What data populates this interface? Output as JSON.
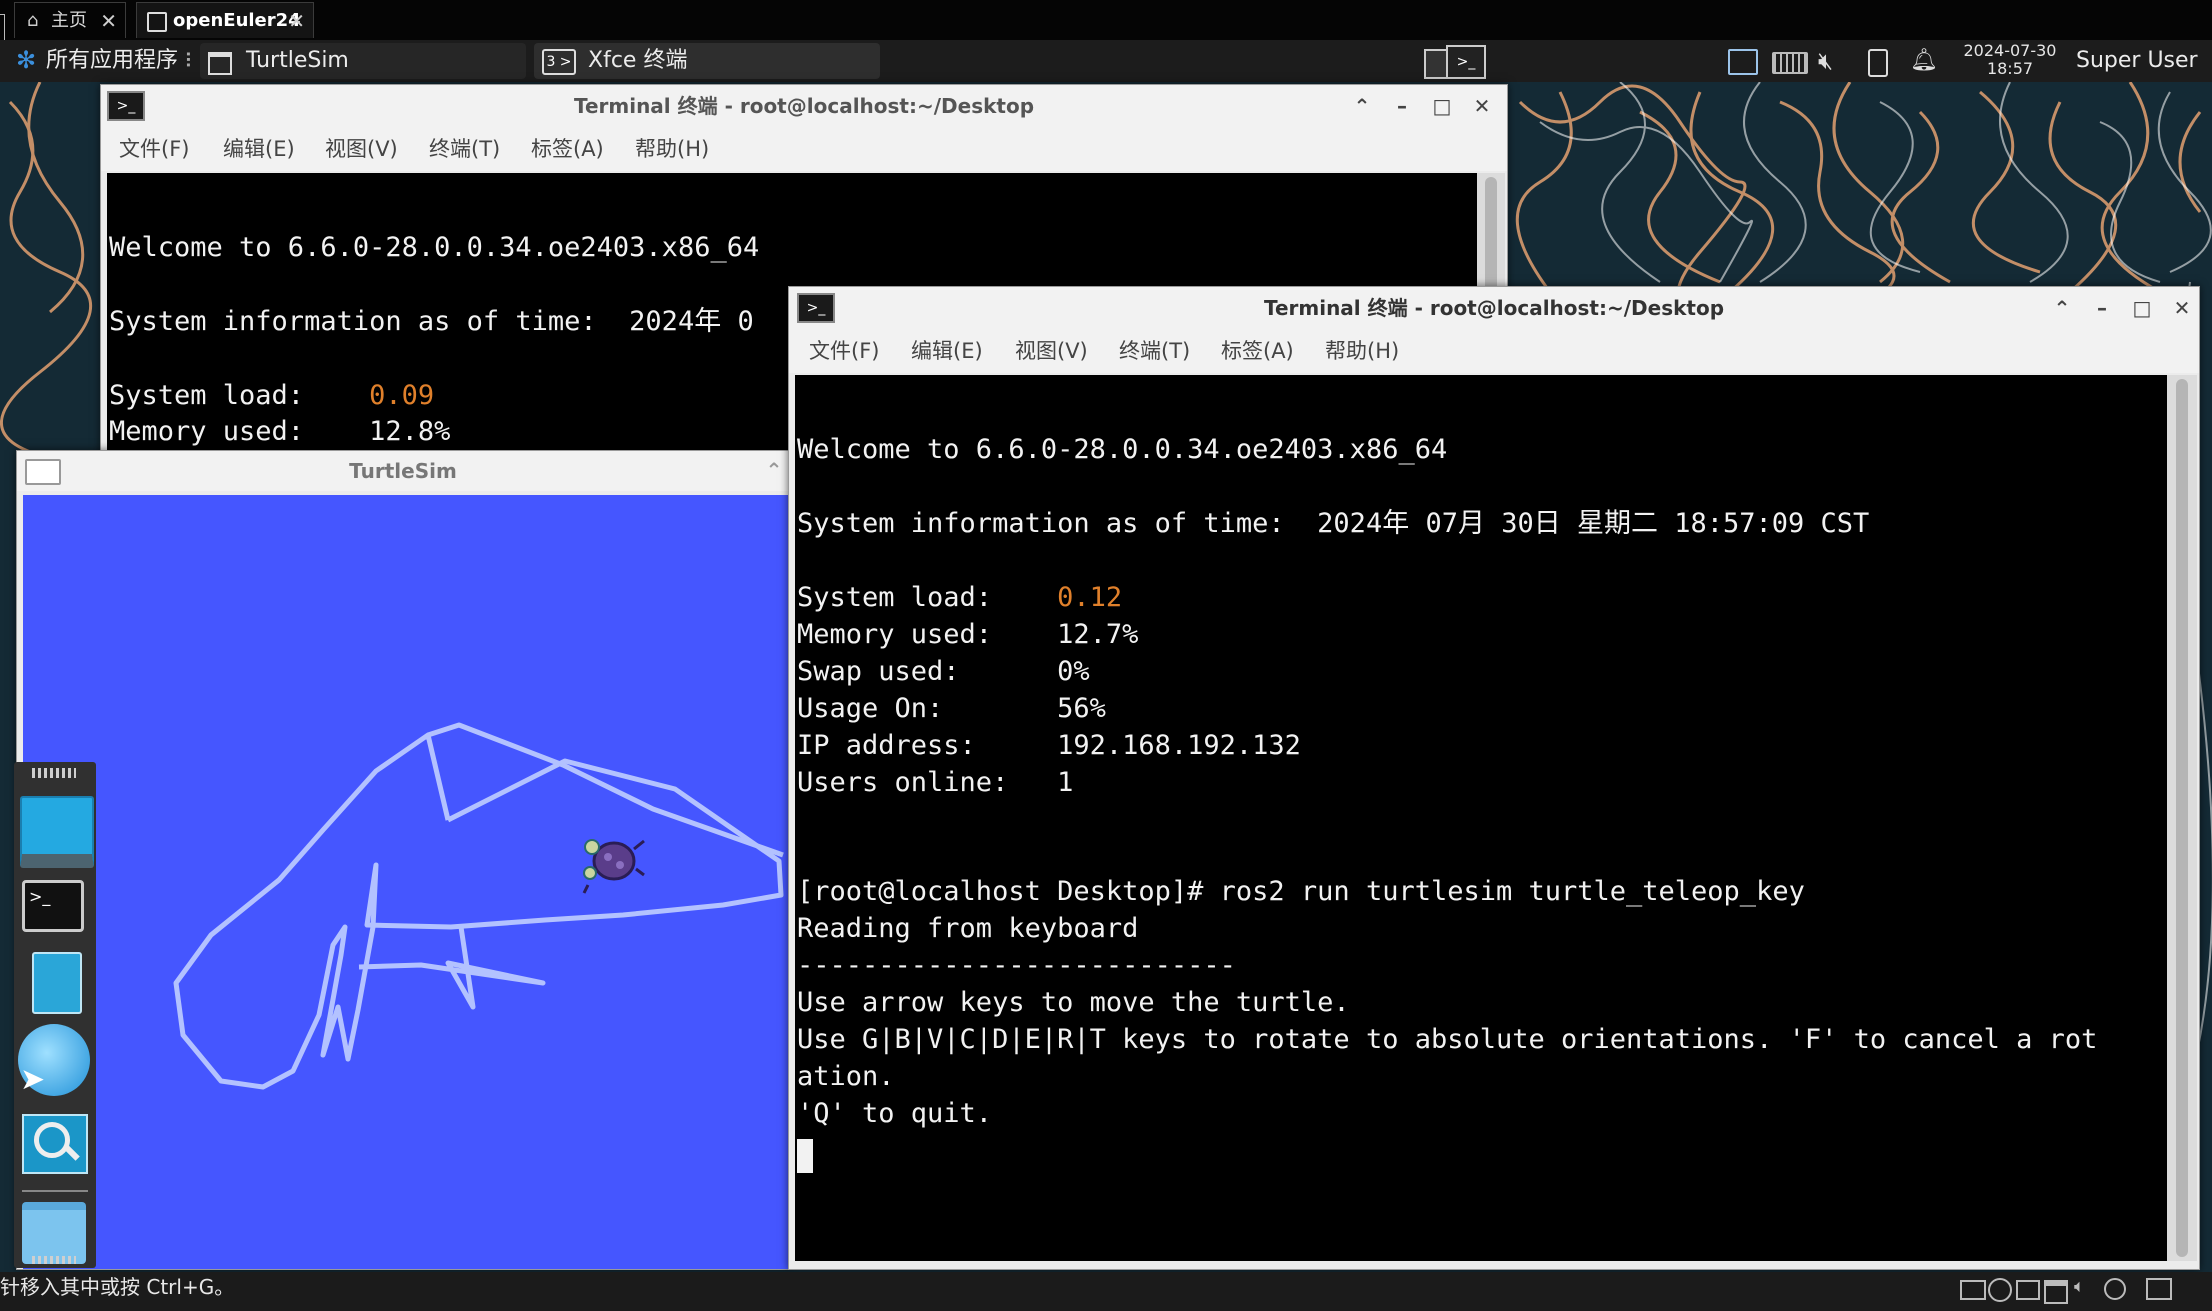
{
  "vm_tabs": [
    {
      "label": "主页",
      "active": false
    },
    {
      "label": "openEuler24",
      "active": true
    }
  ],
  "panel": {
    "apps_menu": "所有应用程序",
    "tasks": [
      {
        "label": "TurtleSim"
      },
      {
        "label": "Xfce 终端"
      }
    ],
    "clock_date": "2024-07-30",
    "clock_time": "18:57",
    "user": "Super User"
  },
  "terminal_back": {
    "title": "Terminal 终端 - root@localhost:~/Desktop",
    "menus": [
      "文件(F)",
      "编辑(E)",
      "视图(V)",
      "终端(T)",
      "标签(A)",
      "帮助(H)"
    ],
    "welcome": "Welcome to 6.6.0-28.0.0.34.oe2403.x86_64",
    "sysinfo": "System information as of time:  2024年 0",
    "load_label": "System load:    ",
    "load_value": "0.09",
    "mem_partial": "Memory used:    12.8%"
  },
  "turtlesim": {
    "title": "TurtleSim",
    "background": "#4556ff",
    "path_color": "#b3c2ff"
  },
  "terminal_front": {
    "title": "Terminal 终端 - root@localhost:~/Desktop",
    "menus": [
      "文件(F)",
      "编辑(E)",
      "视图(V)",
      "终端(T)",
      "标签(A)",
      "帮助(H)"
    ],
    "welcome": "Welcome to 6.6.0-28.0.0.34.oe2403.x86_64",
    "sysinfo": "System information as of time:  2024年 07月 30日 星期二 18:57:09 CST",
    "load_label": "System load:    ",
    "load_value": "0.12",
    "memory": "Memory used:    12.7%",
    "swap": "Swap used:      0%",
    "usage": "Usage On:       56%",
    "ip": "IP address:     192.168.192.132",
    "users": "Users online:   1",
    "command": "[root@localhost Desktop]# ros2 run turtlesim turtle_teleop_key",
    "reading": "Reading from keyboard",
    "divider": "---------------------------",
    "hint1": "Use arrow keys to move the turtle.",
    "hint2a": "Use G|B|V|C|D|E|R|T keys to rotate to absolute orientations. 'F' to cancel a rot",
    "hint2b": "ation.",
    "quit": "'Q' to quit."
  },
  "status_hint": "针移入其中或按 Ctrl+G。",
  "colors": {
    "panel": "#1c1c1c",
    "terminal_bg": "#000000",
    "load_value": "#e0802b"
  }
}
